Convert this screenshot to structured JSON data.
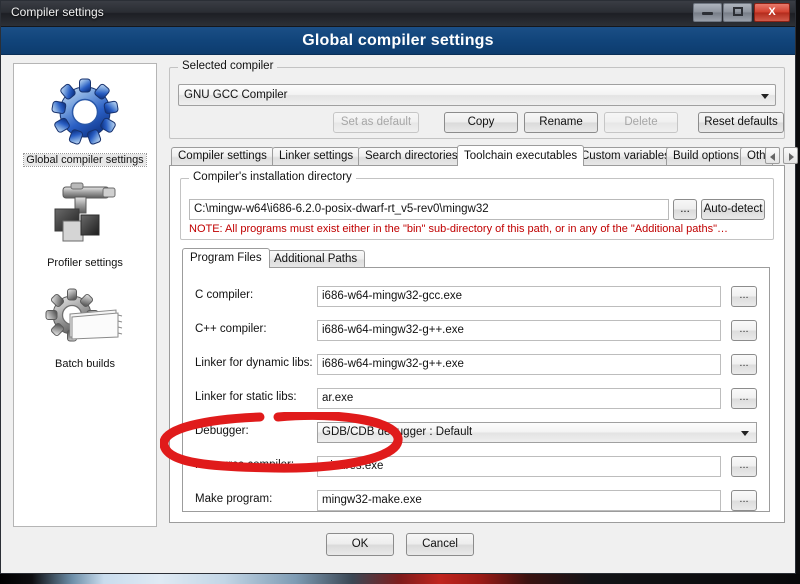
{
  "window": {
    "taskbar_title": "Compiler settings",
    "minimize_label": "Minimize",
    "maximize_label": "Maximize",
    "close_label": "X",
    "header_title": "Global compiler settings"
  },
  "sidebar": {
    "items": [
      {
        "label": "Global compiler settings",
        "icon": "blue-gear-icon",
        "selected": true
      },
      {
        "label": "Profiler settings",
        "icon": "profiler-clamp-icon",
        "selected": false
      },
      {
        "label": "Batch builds",
        "icon": "gear-pages-icon",
        "selected": false
      }
    ]
  },
  "selected_compiler": {
    "legend": "Selected compiler",
    "value": "GNU GCC Compiler",
    "buttons": [
      {
        "label": "Set as default",
        "enabled": false
      },
      {
        "label": "Copy",
        "enabled": true
      },
      {
        "label": "Rename",
        "enabled": true
      },
      {
        "label": "Delete",
        "enabled": false
      },
      {
        "label": "Reset defaults",
        "enabled": true
      }
    ]
  },
  "tabs": {
    "items": [
      {
        "label": "Compiler settings",
        "active": false
      },
      {
        "label": "Linker settings",
        "active": false
      },
      {
        "label": "Search directories",
        "active": false
      },
      {
        "label": "Toolchain executables",
        "active": true
      },
      {
        "label": "Custom variables",
        "active": false
      },
      {
        "label": "Build options",
        "active": false
      },
      {
        "label": "Oth",
        "active": false
      }
    ],
    "scroll_left": "◄",
    "scroll_right": "►"
  },
  "install_dir": {
    "legend": "Compiler's installation directory",
    "value": "C:\\mingw-w64\\i686-6.2.0-posix-dwarf-rt_v5-rev0\\mingw32",
    "browse_label": "...",
    "autodetect_label": "Auto-detect",
    "note": "NOTE: All programs must exist either in the \"bin\" sub-directory of this path, or in any of the \"Additional paths\"…",
    "note_color": "#c00000"
  },
  "inner_tabs": {
    "items": [
      {
        "label": "Program Files",
        "active": true
      },
      {
        "label": "Additional Paths",
        "active": false
      }
    ]
  },
  "program_files": {
    "browse_label": "...",
    "rows": [
      {
        "label": "C compiler:",
        "value": "i686-w64-mingw32-gcc.exe",
        "type": "text"
      },
      {
        "label": "C++ compiler:",
        "value": "i686-w64-mingw32-g++.exe",
        "type": "text"
      },
      {
        "label": "Linker for dynamic libs:",
        "value": "i686-w64-mingw32-g++.exe",
        "type": "text"
      },
      {
        "label": "Linker for static libs:",
        "value": "ar.exe",
        "type": "text"
      },
      {
        "label": "Debugger:",
        "value": "GDB/CDB debugger : Default",
        "type": "combo"
      },
      {
        "label": "Resource compiler:",
        "value": "windres.exe",
        "type": "text"
      },
      {
        "label": "Make program:",
        "value": "mingw32-make.exe",
        "type": "text"
      }
    ]
  },
  "footer": {
    "ok_label": "OK",
    "cancel_label": "Cancel"
  },
  "annotation": {
    "shape": "red-ellipse-highlight",
    "color": "#e01b1b",
    "targets": "Resource compiler: windres.exe"
  },
  "colors": {
    "header_blue": "#11447a",
    "note_red": "#c00000",
    "annotation_red": "#e01b1b",
    "window_bg": "#f0f0f0"
  }
}
